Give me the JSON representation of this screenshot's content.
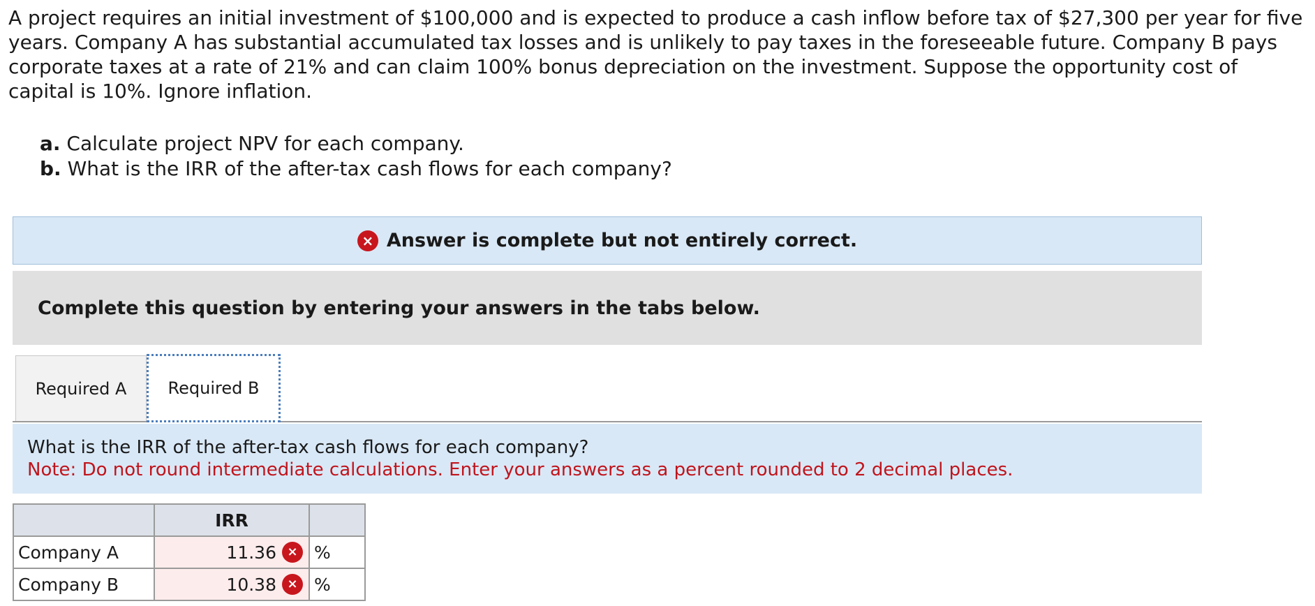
{
  "problem": {
    "text": "A project requires an initial investment of $100,000 and is expected to produce a cash inflow before tax of $27,300 per year for five years. Company A has substantial accumulated tax losses and is unlikely to pay taxes in the foreseeable future. Company B pays corporate taxes at a rate of 21% and can claim 100% bonus depreciation on the investment. Suppose the opportunity cost of capital is 10%. Ignore inflation.",
    "parts": [
      {
        "letter": "a.",
        "text": " Calculate project NPV for each company."
      },
      {
        "letter": "b.",
        "text": " What is the IRR of the after-tax cash flows for each company?"
      }
    ]
  },
  "banner": {
    "icon": "x-circle-icon",
    "icon_glyph": "×",
    "text": "Answer is complete but not entirely correct.",
    "icon_color": "#c8161d"
  },
  "instructions": {
    "text": "Complete this question by entering your answers in the tabs below."
  },
  "tabs": [
    {
      "label": "Required A",
      "active": false
    },
    {
      "label": "Required B",
      "active": true
    }
  ],
  "question": {
    "text": "What is the IRR of the after-tax cash flows for each company?",
    "note": "Note: Do not round intermediate calculations. Enter your answers as a percent rounded to 2 decimal places."
  },
  "table": {
    "header": "IRR",
    "rows": [
      {
        "label": "Company A",
        "value": "11.36",
        "unit": "%",
        "status": "incorrect"
      },
      {
        "label": "Company B",
        "value": "10.38",
        "unit": "%",
        "status": "incorrect"
      }
    ]
  }
}
